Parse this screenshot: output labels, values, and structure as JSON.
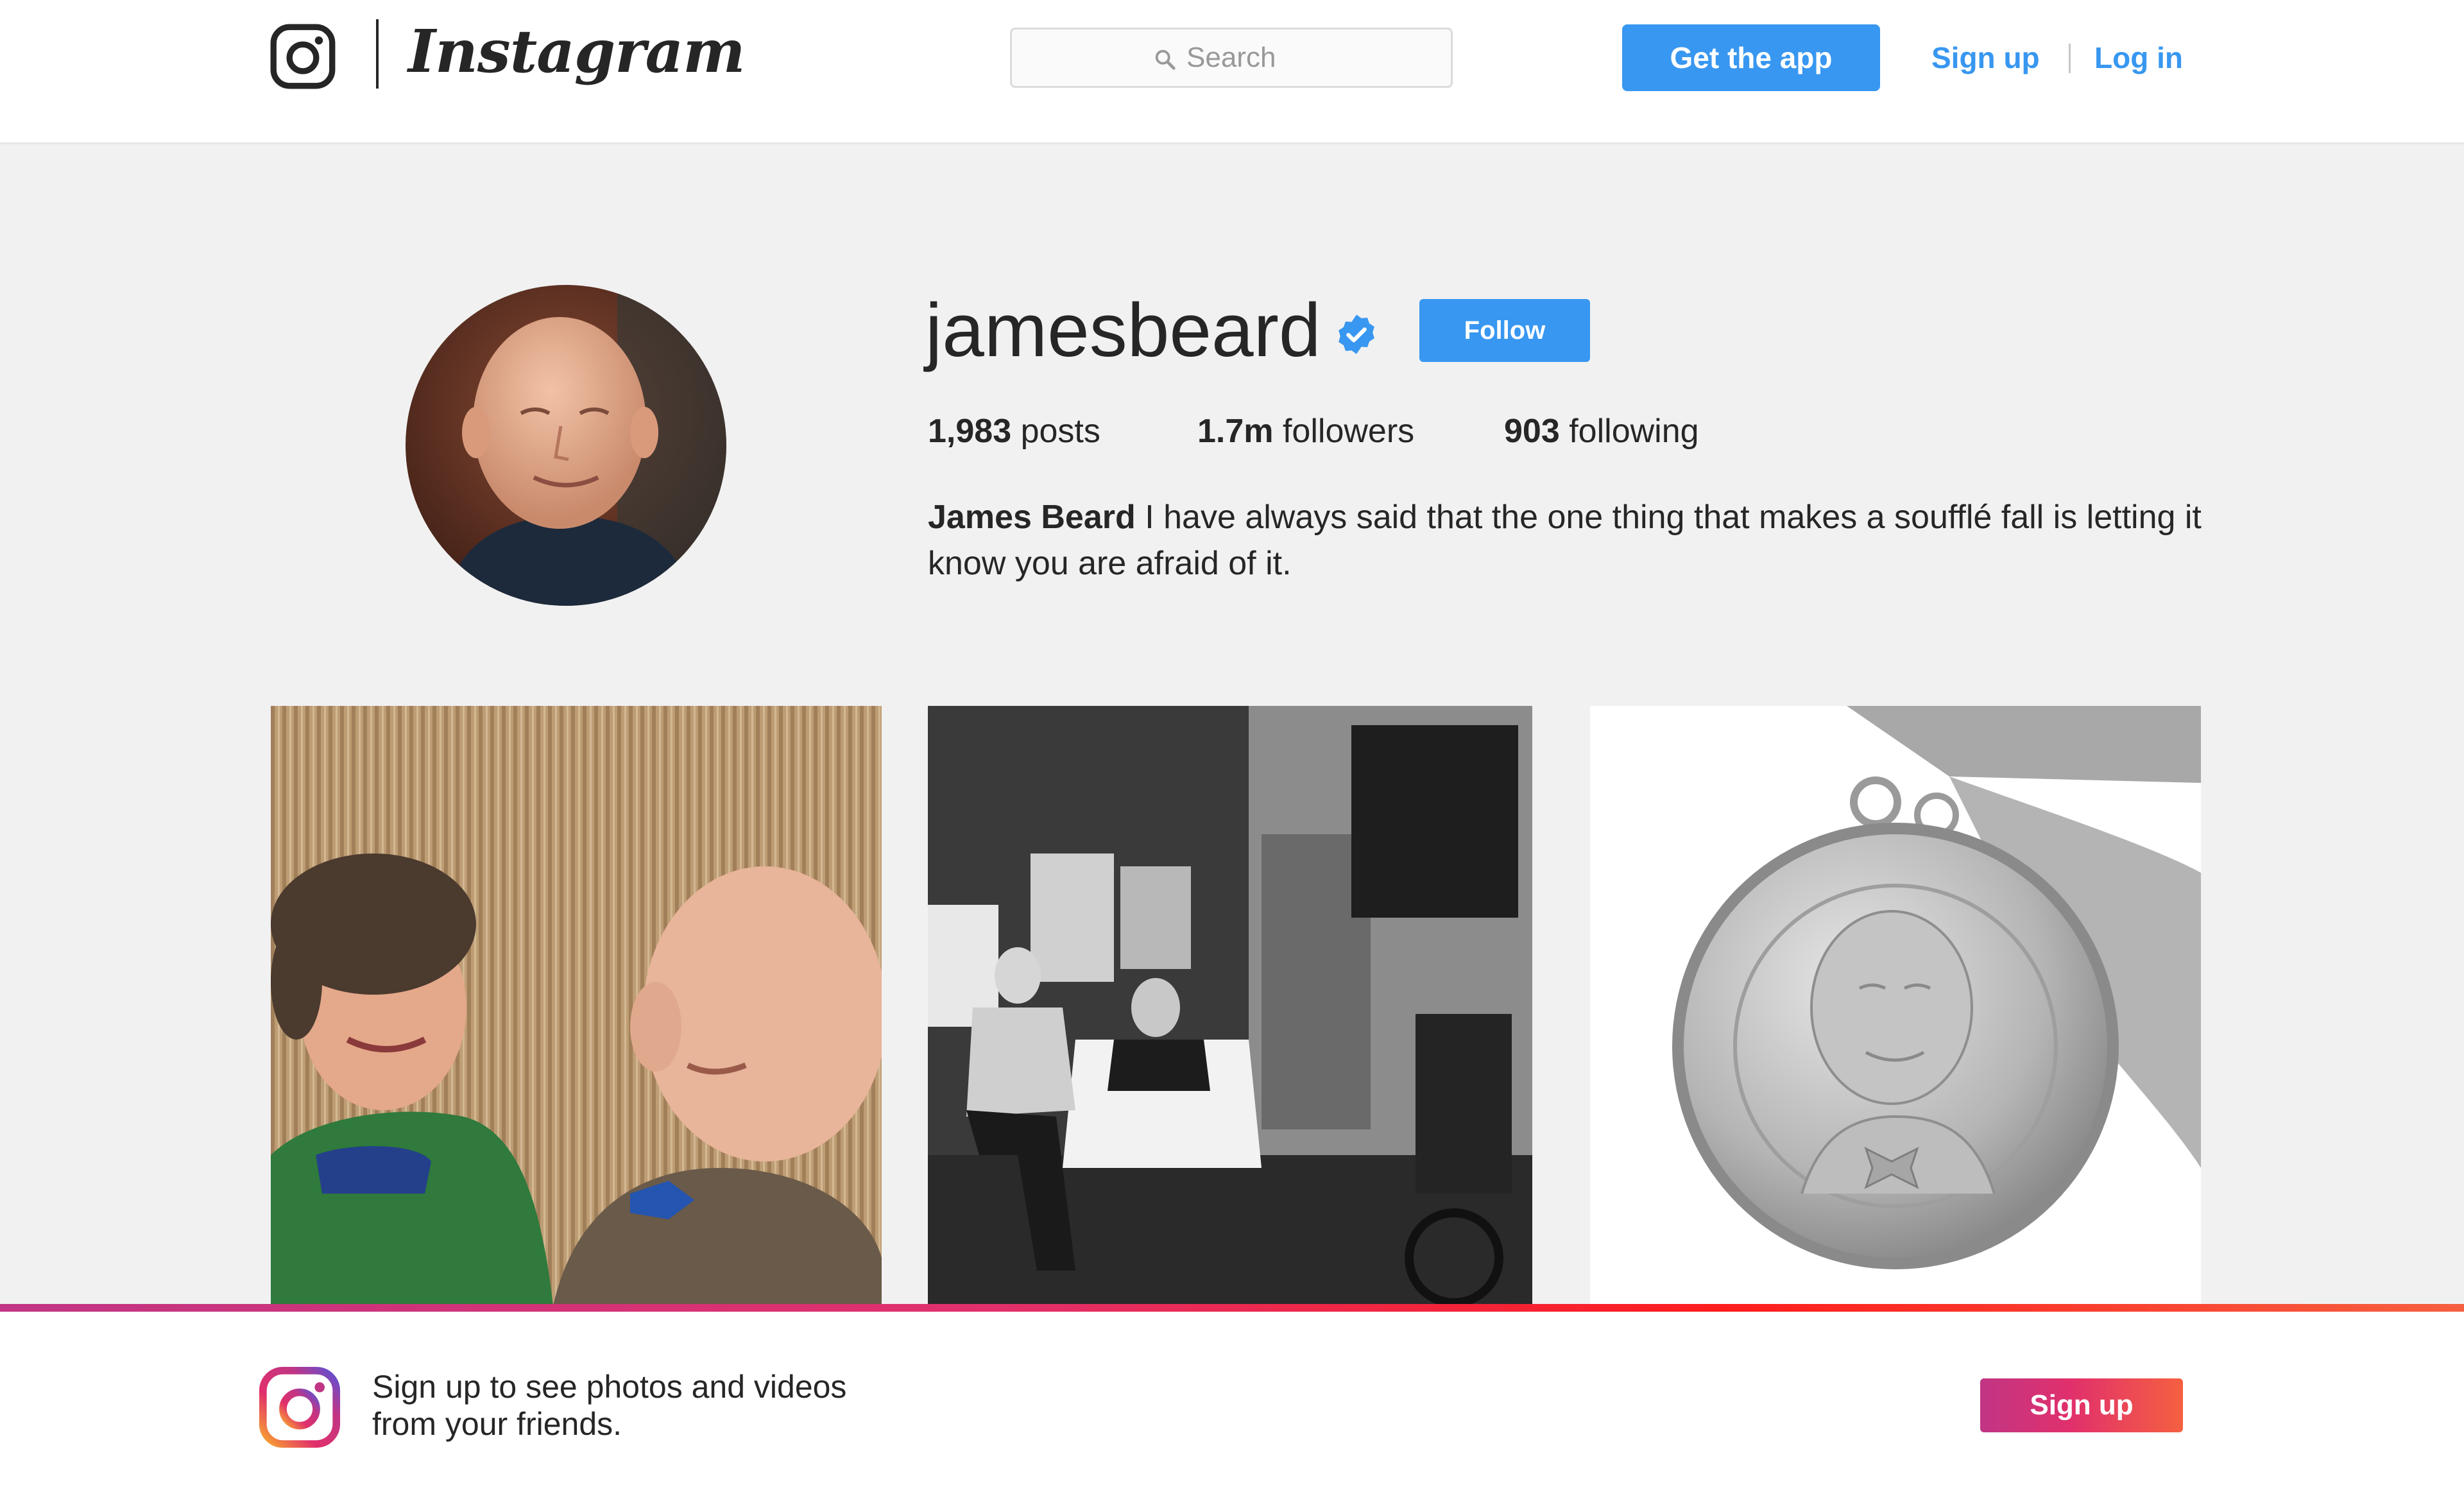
{
  "header": {
    "brand": "Instagram",
    "search": {
      "placeholder": "Search",
      "value": ""
    },
    "get_app_label": "Get the app",
    "signup_label": "Sign up",
    "login_label": "Log in",
    "icons": [
      "instagram-glyph-icon",
      "search-icon"
    ]
  },
  "profile": {
    "username": "jamesbeard",
    "verified": true,
    "follow_label": "Follow",
    "stats": {
      "posts_count": "1,983",
      "posts_label": "posts",
      "followers_count": "1.7m",
      "followers_label": "followers",
      "following_count": "903",
      "following_label": "following"
    },
    "bio_name": "James Beard",
    "bio_text": "I have always said that the one thing that makes a soufflé fall is letting it know you are afraid of it."
  },
  "posts": [
    {
      "kind": "color-photo"
    },
    {
      "kind": "black-and-white-photo"
    },
    {
      "kind": "medal-photo"
    }
  ],
  "banner": {
    "line1": "Sign up to see photos and videos",
    "line2": "from your friends.",
    "signup_label": "Sign up"
  },
  "colors": {
    "accent": "#3897f0",
    "text": "#262626",
    "background": "#f1f1f1",
    "gradient_start": "#c13584",
    "gradient_end": "#f56040"
  }
}
